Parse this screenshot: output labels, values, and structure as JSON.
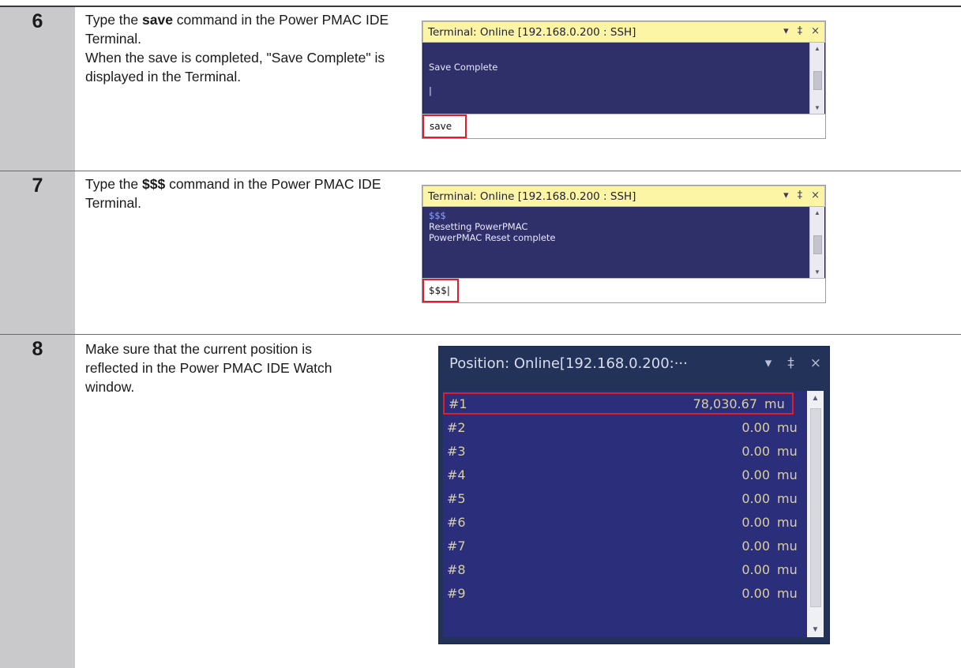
{
  "steps": [
    {
      "number": "6",
      "desc_pre": "Type the ",
      "desc_bold": "save",
      "desc_post": " command in the Power PMAC IDE Terminal.",
      "desc_line2": "When the save is completed, \"Save Complete\" is displayed in the Terminal.",
      "terminal": {
        "title": "Terminal: Online [192.168.0.200 : SSH]",
        "output_lines": [
          "Save Complete",
          "|"
        ],
        "input_value": "save"
      }
    },
    {
      "number": "7",
      "desc_pre": "Type the ",
      "desc_bold": "$$$",
      "desc_post": " command in the Power PMAC IDE Terminal.",
      "terminal": {
        "title": "Terminal: Online [192.168.0.200 : SSH]",
        "output_lines": [
          "$$$",
          "Resetting PowerPMAC",
          "PowerPMAC Reset complete"
        ],
        "input_value": "$$$|"
      }
    },
    {
      "number": "8",
      "desc": "Make sure that the current position is reflected in the Power PMAC IDE Watch window.",
      "watch": {
        "title": "Position: Online[192.168.0.200:···",
        "rows": [
          {
            "label": "#1",
            "value": "78,030.67",
            "unit": "mu"
          },
          {
            "label": "#2",
            "value": "0.00",
            "unit": "mu"
          },
          {
            "label": "#3",
            "value": "0.00",
            "unit": "mu"
          },
          {
            "label": "#4",
            "value": "0.00",
            "unit": "mu"
          },
          {
            "label": "#5",
            "value": "0.00",
            "unit": "mu"
          },
          {
            "label": "#6",
            "value": "0.00",
            "unit": "mu"
          },
          {
            "label": "#7",
            "value": "0.00",
            "unit": "mu"
          },
          {
            "label": "#8",
            "value": "0.00",
            "unit": "mu"
          },
          {
            "label": "#9",
            "value": "0.00",
            "unit": "mu"
          }
        ]
      }
    }
  ],
  "window_buttons": {
    "dropdown": "▾",
    "pin": "‡",
    "close": "×"
  },
  "scroll_arrows": {
    "up": "▲",
    "down": "▼"
  },
  "colors": {
    "terminal_title_bg": "#fdf5a6",
    "terminal_bg": "#2f2f6a",
    "watch_bg": "#2b2e7a",
    "highlight_border": "#e01e2a",
    "step_number_column": "#c9c9cb"
  }
}
